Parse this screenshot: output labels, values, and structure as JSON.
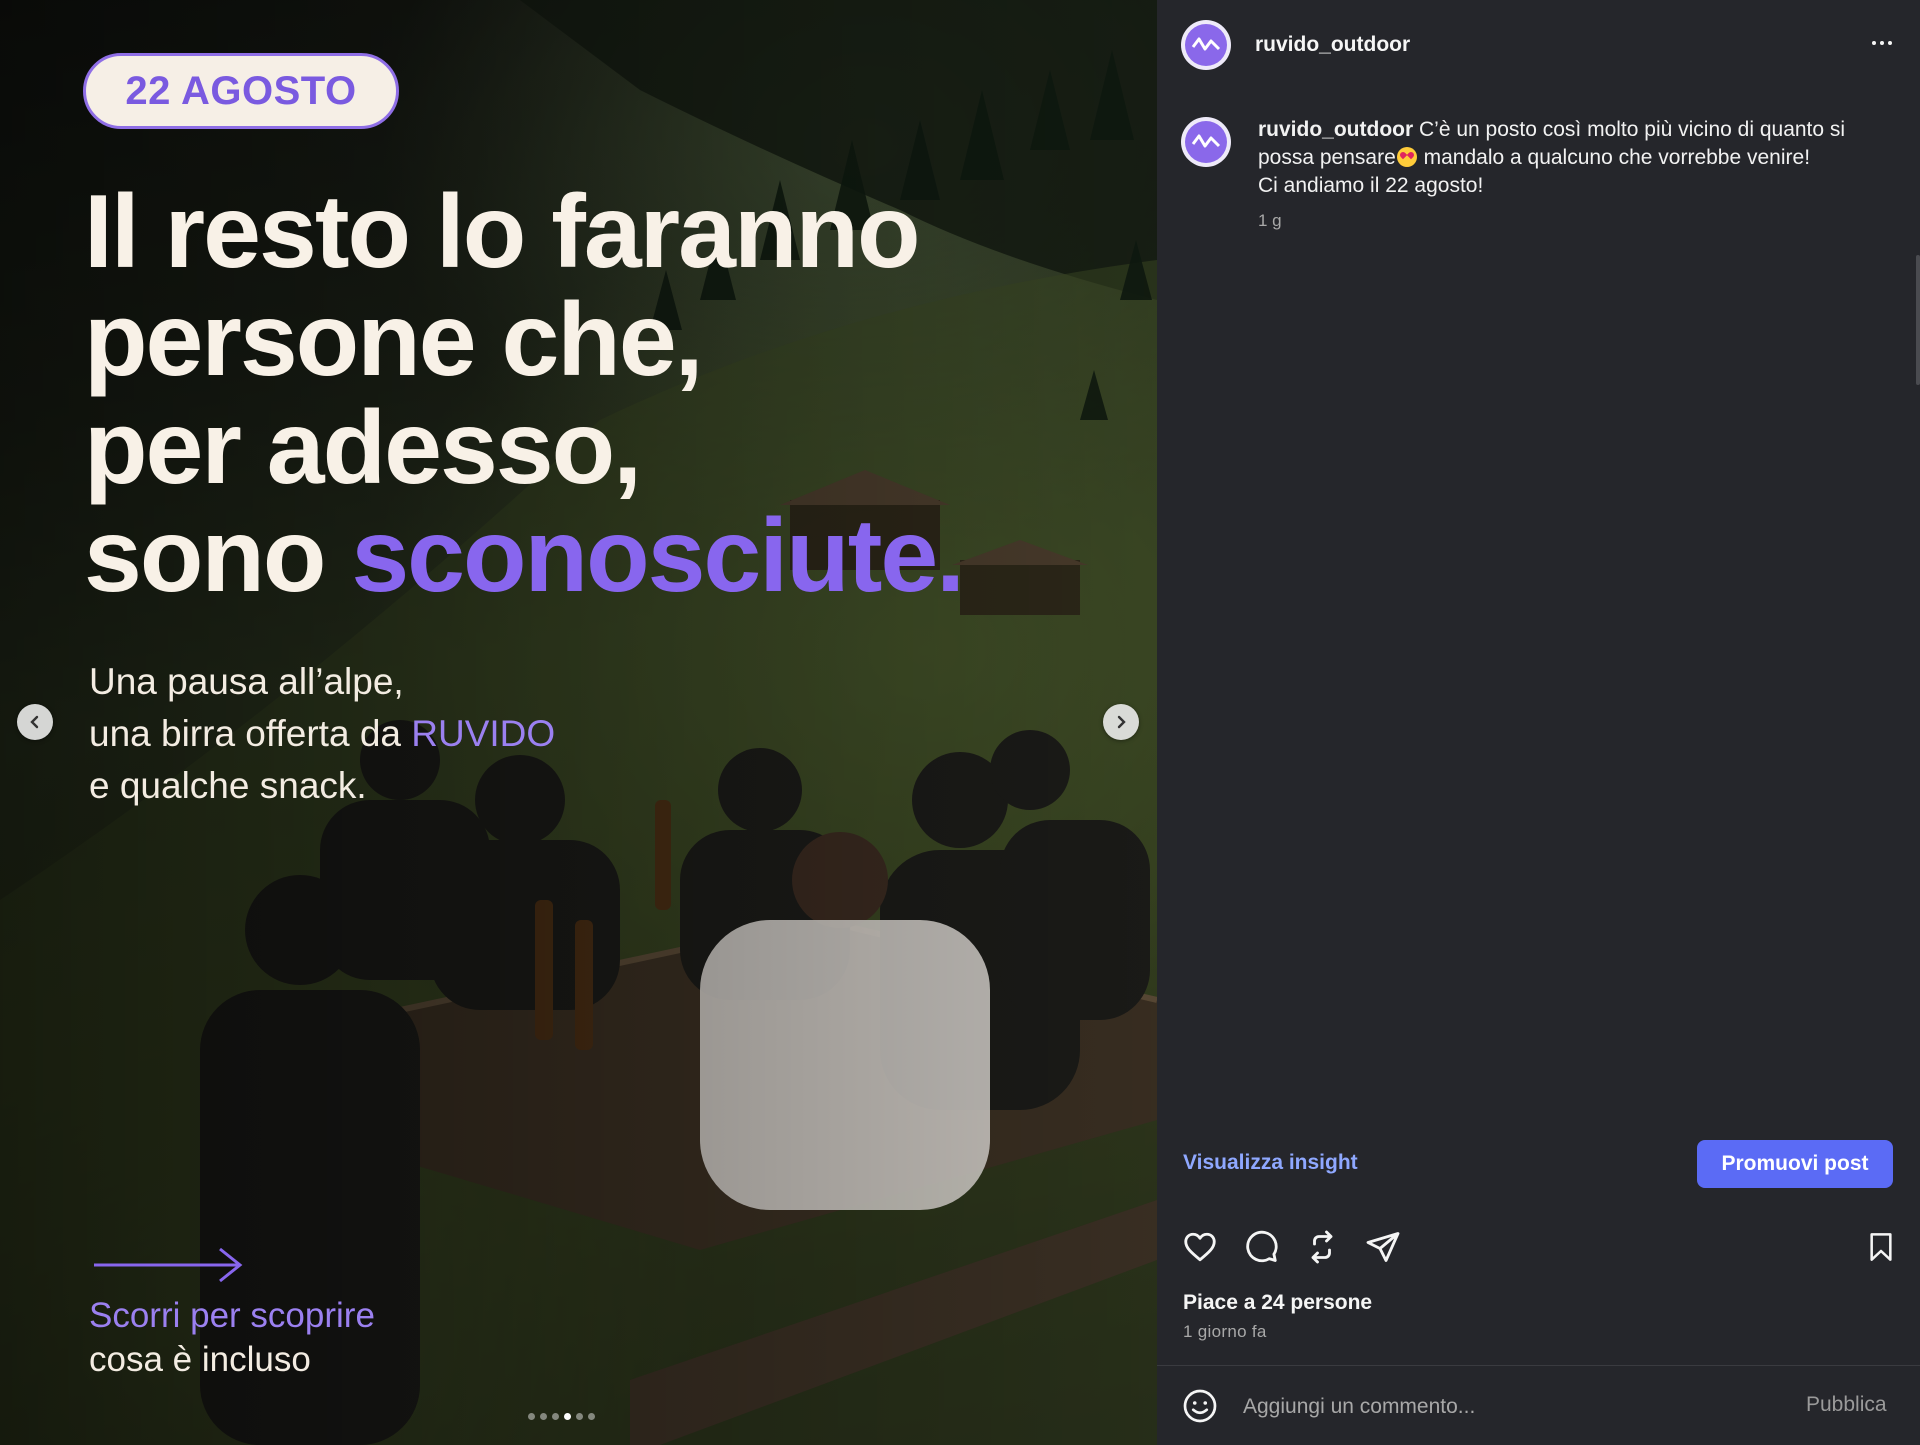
{
  "post": {
    "date_badge": "22 AGOSTO",
    "headline": {
      "line1": "Il resto lo faranno",
      "line2": "persone che,",
      "line3": "per adesso,",
      "line4_plain": "sono",
      "line4_accent": "sconosciute."
    },
    "subcopy": {
      "line1": "Una pausa all’alpe,",
      "line2_plain": "una birra offerta da",
      "line2_accent": "RUVIDO",
      "line3": "e qualche snack."
    },
    "swipe": {
      "title": "Scorri per scoprire",
      "subtitle": "cosa è incluso"
    },
    "carousel": {
      "total": 6,
      "active_index": 3
    }
  },
  "sidebar": {
    "username": "ruvido_outdoor",
    "caption": {
      "user": "ruvido_outdoor",
      "text_before_emoji": "C’è un posto così molto più vicino di quanto si possa pensare",
      "text_after_emoji": "mandalo a qualcuno che vorrebbe venire!",
      "line2": "Ci andiamo il 22 agosto!",
      "emoji_name": "heart-eyes-emoji",
      "time": "1 g"
    },
    "insights_label": "Visualizza insight",
    "promote_label": "Promuovi post",
    "likes": "Piace a 24 persone",
    "posted_ago": "1 giorno fa",
    "comment_placeholder": "Aggiungi un commento...",
    "publish_label": "Pubblica"
  },
  "icons": {
    "more": "more-horizontal-icon",
    "like": "heart-icon",
    "comment": "comment-icon",
    "repost": "repost-icon",
    "share": "send-icon",
    "save": "bookmark-icon",
    "emoji": "smiley-icon",
    "prev": "chevron-left-icon",
    "next": "chevron-right-icon"
  },
  "colors": {
    "background": "#25262b",
    "accent_purple": "#8866ee",
    "link_blue": "#8fa8ff",
    "button_blue": "#5b6bf5"
  }
}
